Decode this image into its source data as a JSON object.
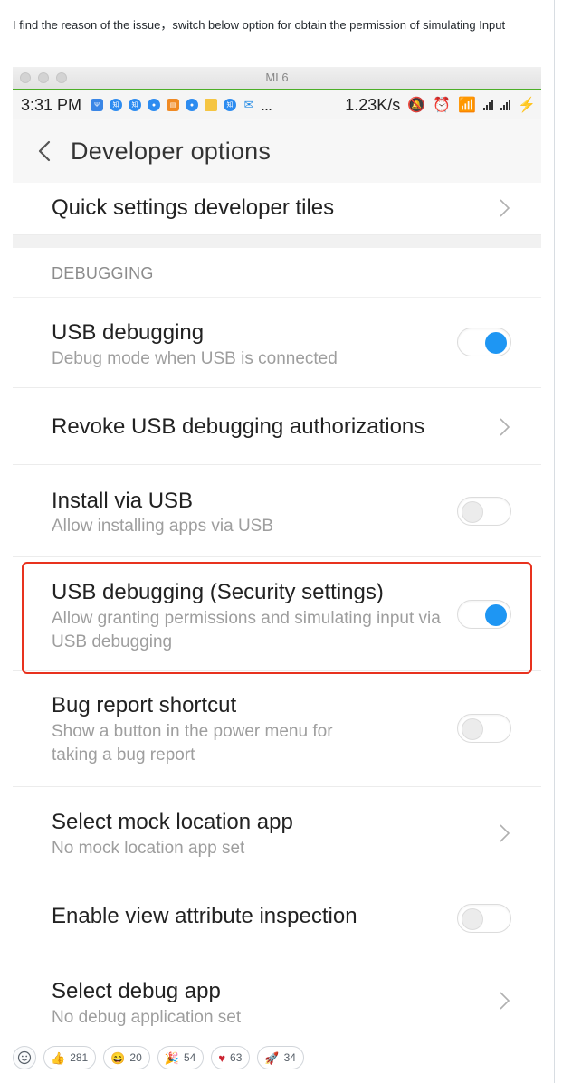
{
  "comment": {
    "text": "I find the reason of the issue，switch below option for obtain the permission of simulating Input"
  },
  "window": {
    "title": "MI 6"
  },
  "statusbar": {
    "time": "3:31 PM",
    "more": "...",
    "speed": "1.23K/s"
  },
  "header": {
    "title": "Developer options",
    "back_icon": "chevron-left-icon"
  },
  "rows": {
    "quick_tiles": {
      "label": "Quick settings developer tiles"
    },
    "section_debugging": {
      "label": "DEBUGGING"
    },
    "usb_debugging": {
      "label": "USB debugging",
      "sub": "Debug mode when USB is connected",
      "enabled": true
    },
    "revoke_usb": {
      "label": "Revoke USB debugging authorizations"
    },
    "install_via_usb": {
      "label": "Install via USB",
      "sub": "Allow installing apps via USB",
      "enabled": false
    },
    "usb_security": {
      "label": "USB debugging (Security settings)",
      "sub": "Allow granting permissions and simulating input via USB debugging",
      "enabled": true
    },
    "bug_report": {
      "label": "Bug report shortcut",
      "sub": "Show a button in the power menu for taking a bug report",
      "enabled": false
    },
    "mock_location": {
      "label": "Select mock location app",
      "sub": "No mock location app set"
    },
    "view_attr": {
      "label": "Enable view attribute inspection",
      "enabled": false
    },
    "debug_app": {
      "label": "Select debug app",
      "sub": "No debug application set"
    }
  },
  "reactions": [
    {
      "icon": "thumbs-up-icon",
      "count": "281"
    },
    {
      "icon": "laugh-icon",
      "count": "20"
    },
    {
      "icon": "tada-icon",
      "count": "54"
    },
    {
      "icon": "heart-icon",
      "count": "63"
    },
    {
      "icon": "rocket-icon",
      "count": "34"
    }
  ],
  "colors": {
    "toggle_on": "#1e96f3",
    "highlight": "#e8321e",
    "accent_line": "#4caf27"
  }
}
